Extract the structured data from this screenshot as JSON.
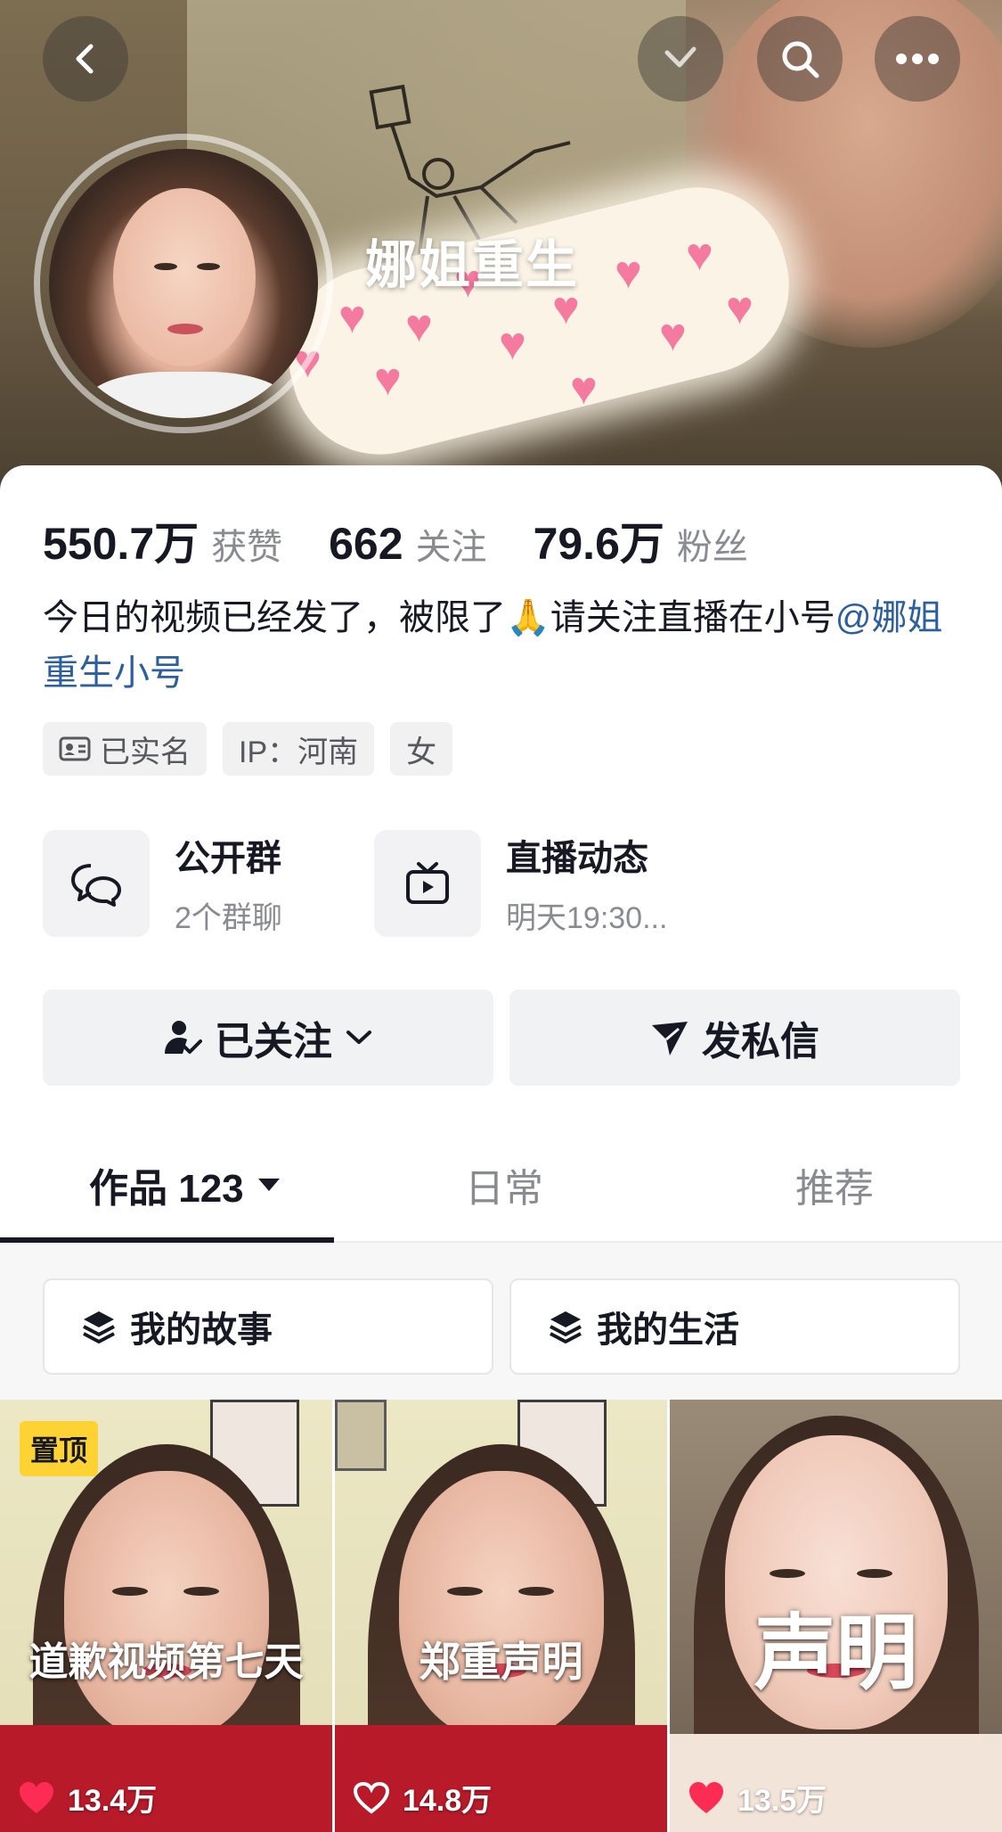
{
  "profile": {
    "username": "娜姐重生",
    "avatar_alt": "avatar"
  },
  "nav": {
    "back_icon": "chevron-left-icon",
    "check_icon": "check-icon",
    "search_icon": "search-icon",
    "more_icon": "more-icon"
  },
  "stats": [
    {
      "value": "550.7万",
      "label": "获赞"
    },
    {
      "value": "662",
      "label": "关注"
    },
    {
      "value": "79.6万",
      "label": "粉丝"
    }
  ],
  "bio": {
    "text": "今日的视频已经发了，被限了🙏请关注直播在小号",
    "mention": "@娜姐重生小号"
  },
  "tags": [
    {
      "label": "已实名",
      "icon": "id-card-icon"
    },
    {
      "label": "IP：河南"
    },
    {
      "label": "女"
    }
  ],
  "features": [
    {
      "title": "公开群",
      "subtitle": "2个群聊",
      "icon": "chat-bubbles-icon"
    },
    {
      "title": "直播动态",
      "subtitle": "明天19:30...",
      "icon": "tv-icon"
    }
  ],
  "actions": {
    "follow_label": "已关注",
    "message_label": "发私信"
  },
  "tabs": [
    {
      "label": "作品 123",
      "active": true
    },
    {
      "label": "日常",
      "active": false
    },
    {
      "label": "推荐",
      "active": false
    }
  ],
  "collections": [
    {
      "label": "我的故事",
      "icon": "layers-icon"
    },
    {
      "label": "我的生活",
      "icon": "layers-icon"
    }
  ],
  "videos": [
    {
      "overlay": "道歉视频第七天",
      "likes": "13.4万",
      "pinned": "置顶",
      "liked": true
    },
    {
      "overlay": "郑重声明",
      "likes": "14.8万",
      "liked": false
    },
    {
      "overlay": "声明",
      "likes": "13.5万",
      "liked": true
    }
  ],
  "colors": {
    "accent_red": "#fe2c55",
    "mention_blue": "#2b5f9e",
    "pin_yellow": "#fdd334"
  }
}
